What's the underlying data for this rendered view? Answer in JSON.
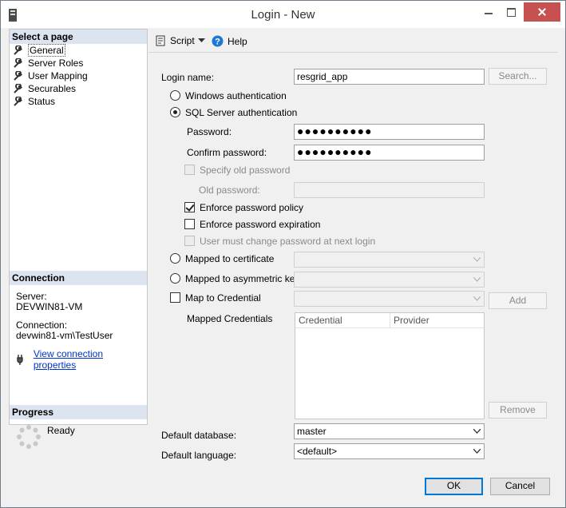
{
  "window": {
    "title": "Login - New"
  },
  "left": {
    "select_page_header": "Select a page",
    "pages": [
      "General",
      "Server Roles",
      "User Mapping",
      "Securables",
      "Status"
    ],
    "connection_header": "Connection",
    "server_label": "Server:",
    "server_value": "DEVWIN81-VM",
    "connection_label": "Connection:",
    "connection_value": "devwin81-vm\\TestUser",
    "view_link": "View connection properties",
    "progress_header": "Progress",
    "progress_status": "Ready"
  },
  "toolbar": {
    "script_label": "Script",
    "help_label": "Help"
  },
  "form": {
    "login_name_label": "Login name:",
    "login_name_value": "resgrid_app",
    "search_label": "Search...",
    "windows_auth_label": "Windows authentication",
    "sql_auth_label": "SQL Server authentication",
    "password_label": "Password:",
    "password_value": "●●●●●●●●●●",
    "confirm_password_label": "Confirm password:",
    "confirm_password_value": "●●●●●●●●●●",
    "specify_old_label": "Specify old password",
    "old_password_label": "Old password:",
    "enforce_policy_label": "Enforce password policy",
    "enforce_expiration_label": "Enforce password expiration",
    "must_change_label": "User must change password at next login",
    "mapped_cert_label": "Mapped to certificate",
    "mapped_asym_label": "Mapped to asymmetric key",
    "map_credential_label": "Map to Credential",
    "add_label": "Add",
    "mapped_credentials_label": "Mapped Credentials",
    "credential_col": "Credential",
    "provider_col": "Provider",
    "remove_label": "Remove",
    "default_db_label": "Default database:",
    "default_db_value": "master",
    "default_lang_label": "Default language:",
    "default_lang_value": "<default>"
  },
  "footer": {
    "ok_label": "OK",
    "cancel_label": "Cancel"
  },
  "colors": {
    "section_header_bg": "#dbe4ef",
    "close_button": "#c75050",
    "link": "#0033cc"
  }
}
